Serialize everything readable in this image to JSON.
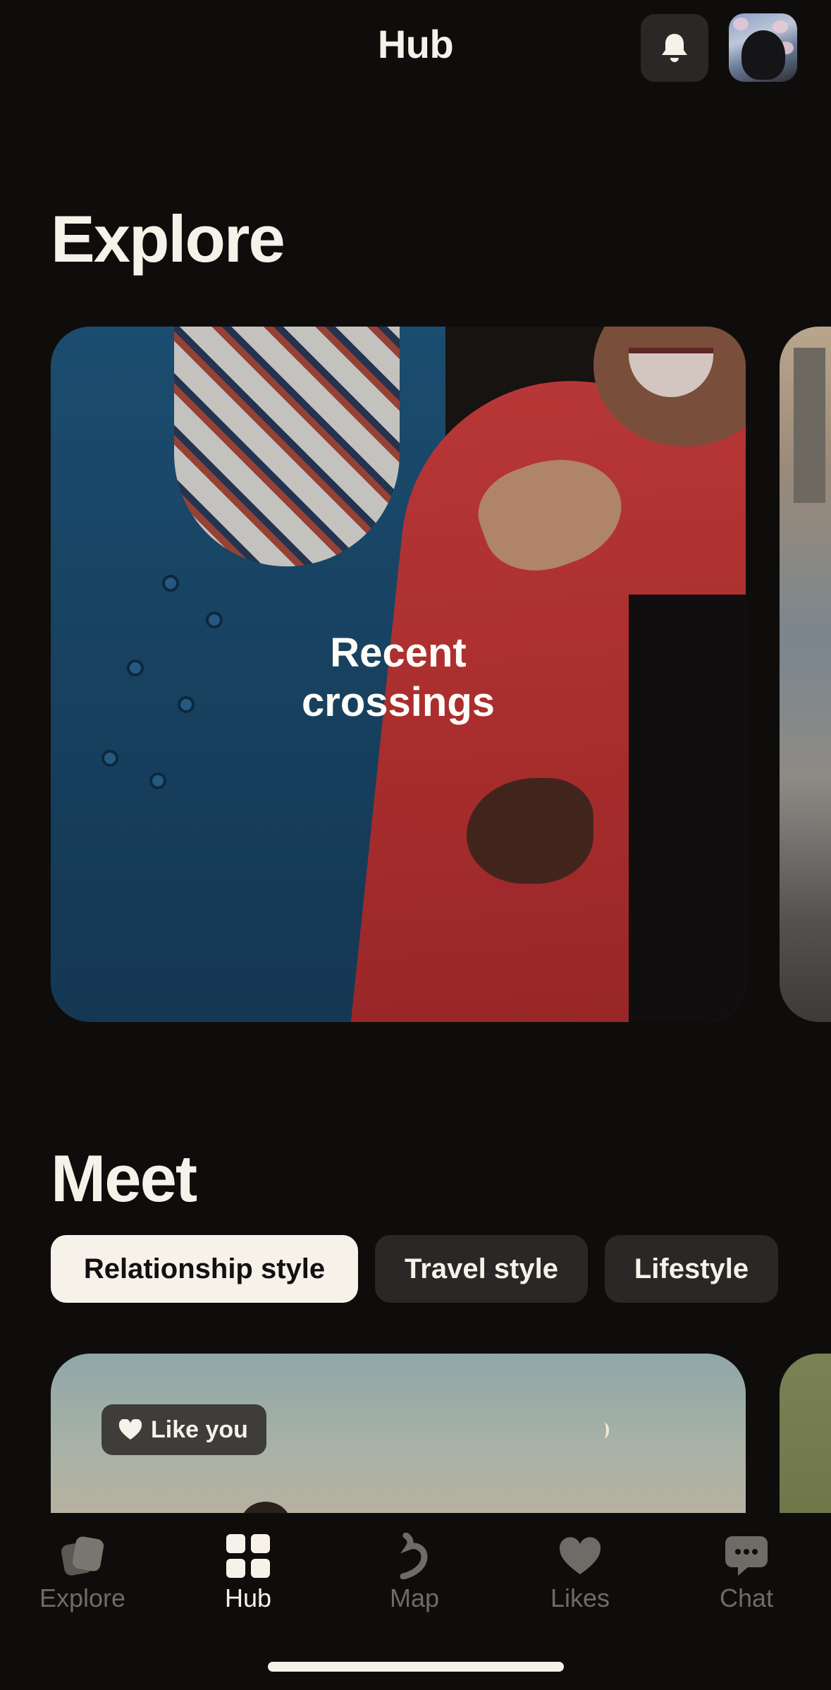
{
  "header": {
    "title": "Hub",
    "notifications_icon": "bell-icon",
    "avatar_icon": "profile-avatar"
  },
  "explore": {
    "title": "Explore",
    "cards": [
      {
        "label_line1": "Recent",
        "label_line2": "crossings"
      }
    ]
  },
  "meet": {
    "title": "Meet",
    "chips": [
      {
        "label": "Relationship style",
        "selected": true
      },
      {
        "label": "Travel style",
        "selected": false
      },
      {
        "label": "Lifestyle",
        "selected": false
      }
    ],
    "card": {
      "badge": "Like you",
      "badge_icon": "heart-icon"
    }
  },
  "tabbar": {
    "tabs": [
      {
        "label": "Explore",
        "icon": "cards-icon",
        "active": false
      },
      {
        "label": "Hub",
        "icon": "grid-icon",
        "active": true
      },
      {
        "label": "Map",
        "icon": "map-icon",
        "active": false
      },
      {
        "label": "Likes",
        "icon": "heart-icon",
        "active": false
      },
      {
        "label": "Chat",
        "icon": "chat-icon",
        "active": false
      }
    ]
  },
  "colors": {
    "background": "#0f0d0b",
    "text": "#f6f2ea",
    "chip": "#2a2826",
    "chip_active": "#f6f2ea",
    "tab_inactive": "#6f6b66"
  }
}
